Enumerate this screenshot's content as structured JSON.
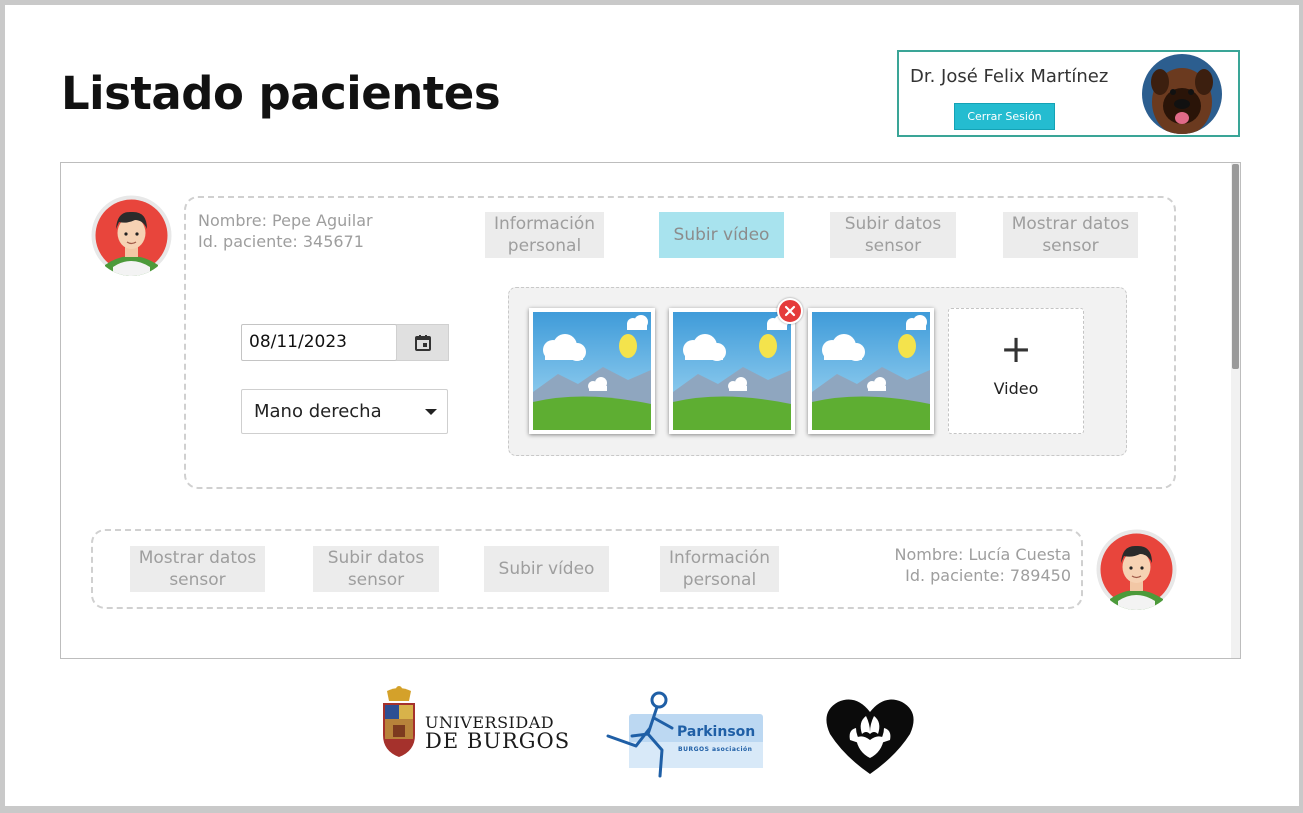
{
  "page": {
    "title": "Listado pacientes"
  },
  "user": {
    "name": "Dr. José Felix Martínez",
    "logout_label": "Cerrar Sesión"
  },
  "patients": [
    {
      "name_line": "Nombre: Pepe Aguilar",
      "id_line": "Id. paciente: 345671",
      "tabs": {
        "personal_info": "Información personal",
        "upload_video": "Subir vídeo",
        "upload_sensor": "Subir datos sensor",
        "show_sensor": "Mostrar datos sensor"
      },
      "active_tab": "Subir vídeo",
      "date_value": "08/11/2023",
      "hand_selected": "Mano derecha",
      "video_count": 3,
      "add_video_label": "Video"
    },
    {
      "name_line": "Nombre: Lucía Cuesta",
      "id_line": "Id. paciente: 789450",
      "tabs": {
        "personal_info": "Información personal",
        "upload_video": "Subir vídeo",
        "upload_sensor": "Subir datos sensor",
        "show_sensor": "Mostrar datos sensor"
      }
    }
  ],
  "footer": {
    "logo_ub": {
      "line1": "UNIVERSIDAD",
      "line2": "DE BURGOS"
    },
    "logo_parkinson": {
      "title": "Parkinson",
      "subtitle": "BURGOS asociación"
    }
  },
  "icons": {
    "calendar": "calendar-icon",
    "delete": "close-circle-icon",
    "add": "plus-icon",
    "dropdown": "caret-down-icon"
  },
  "colors": {
    "accent_teal": "#3aa597",
    "button_cyan": "#24bcd0",
    "active_tab": "#a8e3ee",
    "delete_red": "#e53b3b"
  }
}
